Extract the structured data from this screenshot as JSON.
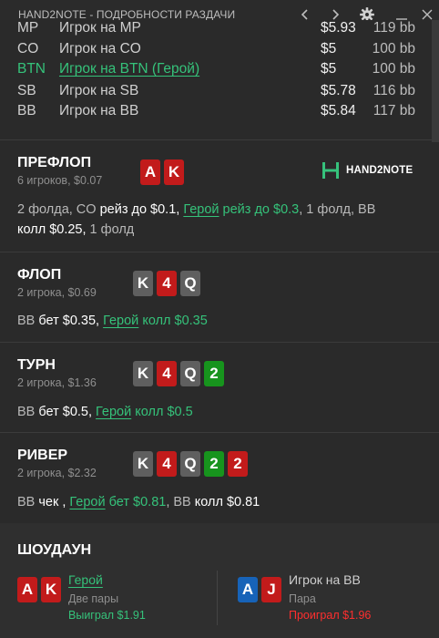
{
  "window": {
    "title": "HAND2NOTE - ПОДРОБНОСТИ РАЗДАЧИ",
    "back_icon": "chevron-left-icon",
    "forward_icon": "chevron-right-icon",
    "settings_icon": "gear-icon",
    "minimize_icon": "minimize-icon",
    "close_icon": "close-icon"
  },
  "colors": {
    "hero_green": "#35c27a",
    "card_red": "#c21b1b",
    "card_gray": "#5f5f5f",
    "card_green": "#17941d",
    "card_blue": "#1763b8",
    "win_green": "#35c27a",
    "lose_red": "#ff2e2e"
  },
  "seats": [
    {
      "pos": "MP",
      "name": "Игрок на MP",
      "stack": "$5.93",
      "bb": "119 bb"
    },
    {
      "pos": "CO",
      "name": "Игрок на CO",
      "stack": "$5",
      "bb": "100 bb"
    },
    {
      "pos": "BTN",
      "name": "Игрок на BTN (Герой)",
      "stack": "$5",
      "bb": "100 bb"
    },
    {
      "pos": "SB",
      "name": "Игрок на SB",
      "stack": "$5.78",
      "bb": "116 bb"
    },
    {
      "pos": "BB",
      "name": "Игрок на BB",
      "stack": "$5.84",
      "bb": "117 bb"
    }
  ],
  "logo": {
    "text": "HAND2NOTE"
  },
  "preflop": {
    "title": "ПРЕФЛОП",
    "sub": "6 игроков, $0.07",
    "cards": [
      "A",
      "K"
    ],
    "a1": "2 фолда, CO",
    "a2": " рейз до $0.1, ",
    "a3": "Герой",
    "a4": " рейз до $0.3",
    "a5": ", 1 фолд, BB",
    "a6": " колл $0.25, ",
    "a7": "1 фолд"
  },
  "flop": {
    "title": "ФЛОП",
    "sub": "2 игрока, $0.69",
    "cards": [
      "K",
      "4",
      "Q"
    ],
    "a1": "BB",
    "a2": " бет $0.35, ",
    "a3": "Герой",
    "a4": " колл $0.35"
  },
  "turn": {
    "title": "ТУРН",
    "sub": "2 игрока, $1.36",
    "cards": [
      "K",
      "4",
      "Q",
      "2"
    ],
    "a1": "BB",
    "a2": " бет $0.5, ",
    "a3": "Герой",
    "a4": " колл $0.5"
  },
  "river": {
    "title": "РИВЕР",
    "sub": "2 игрока, $2.32",
    "cards": [
      "K",
      "4",
      "Q",
      "2",
      "2"
    ],
    "a1": "BB",
    "a2": " чек , ",
    "a3": "Герой",
    "a4": " бет $0.81",
    "a5": ", BB",
    "a6": " колл $0.81"
  },
  "showdown": {
    "title": "ШОУДАУН",
    "hero": {
      "cards": [
        "A",
        "K"
      ],
      "name": "Герой",
      "hand": "Две пары",
      "result": "Выиграл $1.91"
    },
    "villain": {
      "cards": [
        "A",
        "J"
      ],
      "name": "Игрок на BB",
      "hand": "Пара",
      "result": "Проиграл $1.96"
    }
  }
}
